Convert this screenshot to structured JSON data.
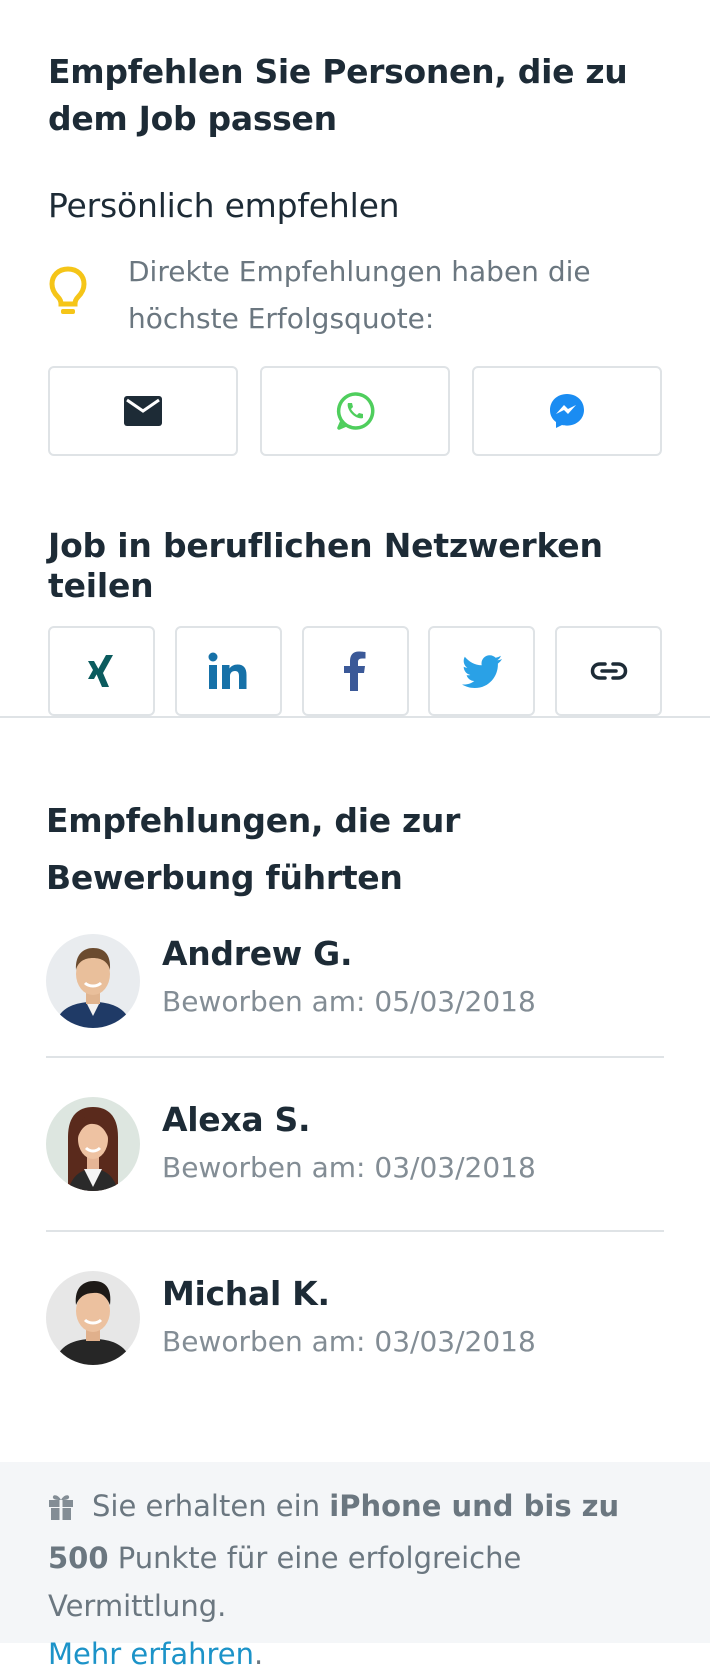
{
  "main_title": "Empfehlen Sie Personen, die zu dem Job passen",
  "personal": {
    "title": "Persönlich empfehlen",
    "tip": "Direkte Empfehlungen haben die höchste Erfolgsquote:",
    "tip_icon": "lightbulb-icon",
    "buttons": [
      {
        "name": "email",
        "icon": "envelope-icon",
        "color": "#1d2b36"
      },
      {
        "name": "whatsapp",
        "icon": "whatsapp-icon",
        "color": "#4fce5d"
      },
      {
        "name": "messenger",
        "icon": "messenger-icon",
        "color": "#1a8cf2"
      }
    ]
  },
  "networks": {
    "title": "Job in beruflichen Netzwerken teilen",
    "buttons": [
      {
        "name": "xing",
        "icon": "xing-icon",
        "color": "#0b5b5e"
      },
      {
        "name": "linkedin",
        "icon": "linkedin-icon",
        "color": "#1671a8"
      },
      {
        "name": "facebook",
        "icon": "facebook-icon",
        "color": "#3b5998"
      },
      {
        "name": "twitter",
        "icon": "twitter-icon",
        "color": "#2aa1e6"
      },
      {
        "name": "copy-link",
        "icon": "link-icon",
        "color": "#1d2b36"
      }
    ]
  },
  "referrals": {
    "title": "Empfehlungen, die zur Bewerbung führten",
    "people": [
      {
        "name": "Andrew G.",
        "date": "Beworben am: 05/03/2018"
      },
      {
        "name": "Alexa S.",
        "date": "Beworben am: 03/03/2018"
      },
      {
        "name": "Michal K.",
        "date": "Beworben am: 03/03/2018"
      }
    ]
  },
  "footer": {
    "icon": "gift-icon",
    "text_before": "Sie erhalten ein ",
    "text_bold": "iPhone und bis zu 500",
    "text_after": " Punkte für eine erfolgreiche Vermittlung.",
    "link": "Mehr erfahren",
    "link_suffix": "."
  },
  "colors": {
    "accent_link": "#1c93c8",
    "tip_icon": "#f5c518",
    "border": "#dfe3e6"
  }
}
